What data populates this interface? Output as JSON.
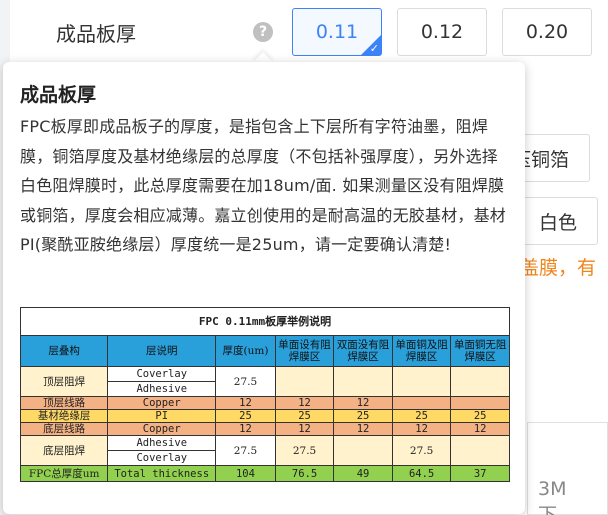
{
  "field": {
    "label": "成品板厚",
    "help_glyph": "?",
    "options": [
      "0.11",
      "0.12",
      "0.20"
    ],
    "selected": "0.11"
  },
  "background": {
    "copper_option": "压铜箔",
    "color_option": "白色",
    "notice": "盖膜，有",
    "panel_text_1": "3M",
    "panel_text_2": "下"
  },
  "tooltip": {
    "title": "成品板厚",
    "body": "FPC板厚即成品板子的厚度，是指包含上下层所有字符油墨，阻焊膜，铜箔厚度及基材绝缘层的总厚度（不包括补强厚度），另外选择白色阻焊膜时，此总厚度需要在加18um/面. 如果测量区没有阻焊膜或铜箔，厚度会相应减薄。嘉立创使用的是耐高温的无胶基材，基材PI(聚酰亚胺绝缘层）厚度统一是25um，请一定要确认清楚!"
  },
  "example_table": {
    "title": "FPC 0.11mm板厚举例说明",
    "headers": [
      "层叠构",
      "层说明",
      "厚度(um)",
      "单面设有阻焊膜区",
      "双面没有阻焊膜区",
      "单面铜及阻焊膜区",
      "单面铜无阻焊膜区"
    ],
    "rows": {
      "top_mask": {
        "layer": "顶层阻焊",
        "sub1": "Coverlay",
        "sub2": "Adhesive",
        "thickness": "27.5"
      },
      "top_copper": {
        "layer": "顶层线路",
        "desc": "Copper",
        "vals": [
          "12",
          "12",
          "12",
          "",
          ""
        ]
      },
      "base": {
        "layer": "基材绝缘层",
        "desc": "PI",
        "vals": [
          "25",
          "25",
          "25",
          "25",
          "25"
        ]
      },
      "bottom_copper": {
        "layer": "底层线路",
        "desc": "Copper",
        "vals": [
          "12",
          "12",
          "12",
          "12",
          "12"
        ]
      },
      "bottom_mask": {
        "layer": "底层阻焊",
        "sub1": "Adhesive",
        "sub2": "Coverlay",
        "vals": [
          "27.5",
          "27.5",
          "",
          "27.5",
          ""
        ]
      },
      "total": {
        "layer": "FPC总厚度um",
        "desc": "Total thickness",
        "vals": [
          "104",
          "76.5",
          "49",
          "64.5",
          "37"
        ]
      }
    }
  }
}
